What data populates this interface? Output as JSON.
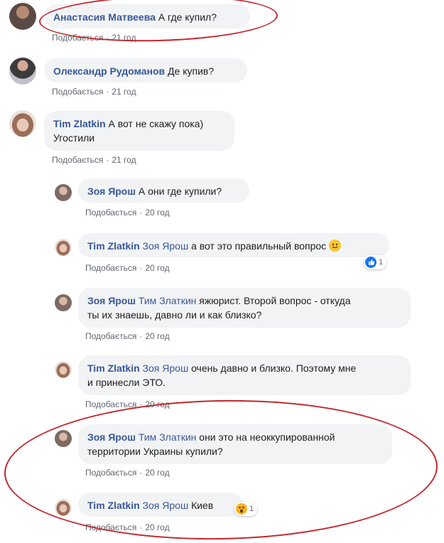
{
  "comments": [
    {
      "author": "Анастасия Матвеева",
      "tag": "",
      "text": "А где купил?",
      "like": "Подобається",
      "time": "21 год"
    },
    {
      "author": "Олександр Рудоманов",
      "tag": "",
      "text": "Де купив?",
      "like": "Подобається",
      "time": "21 год"
    },
    {
      "author": "Tim Zlatkin",
      "tag": "",
      "text": "А вот не скажу пока)",
      "text2": "Угостили",
      "like": "Подобається",
      "time": "21 год"
    }
  ],
  "replies": [
    {
      "author": "Зоя Ярош",
      "tag": "",
      "text": "А они где купили?",
      "like": "Подобається",
      "time": "20 год"
    },
    {
      "author": "Tim Zlatkin",
      "tag": "Зоя Ярош",
      "text": "а вот это правильный вопрос",
      "like": "Подобається",
      "time": "20 год",
      "reaction": {
        "icon": "like-icon",
        "count": "1"
      }
    },
    {
      "author": "Зоя Ярош",
      "tag": "Тим Златкин",
      "text": "яжюрист. Второй вопрос - откуда",
      "text2": "ты их знаешь, давно ли и как близко?",
      "like": "Подобається",
      "time": "20 год"
    },
    {
      "author": "Tim Zlatkin",
      "tag": "Зоя Ярош",
      "text": "очень давно и близко. Поэтому мне",
      "text2": "и принесли ЭТО.",
      "like": "Подобається",
      "time": "20 год"
    },
    {
      "author": "Зоя Ярош",
      "tag": "Тим Златкин",
      "text": "они это на неоккупированной",
      "text2": "территории Украины купили?",
      "like": "Подобається",
      "time": "20 год"
    },
    {
      "author": "Tim Zlatkin",
      "tag": "Зоя Ярош",
      "text": "Киев",
      "like": "Подобається",
      "time": "20 год",
      "reaction": {
        "icon": "wow-icon",
        "count": "1"
      }
    }
  ],
  "colors": {
    "name": "#385898",
    "bubble": "#f2f3f5",
    "meta": "#606770",
    "annotation": "#c2272d",
    "like": "#1877f2",
    "wow": "#f7b125"
  }
}
